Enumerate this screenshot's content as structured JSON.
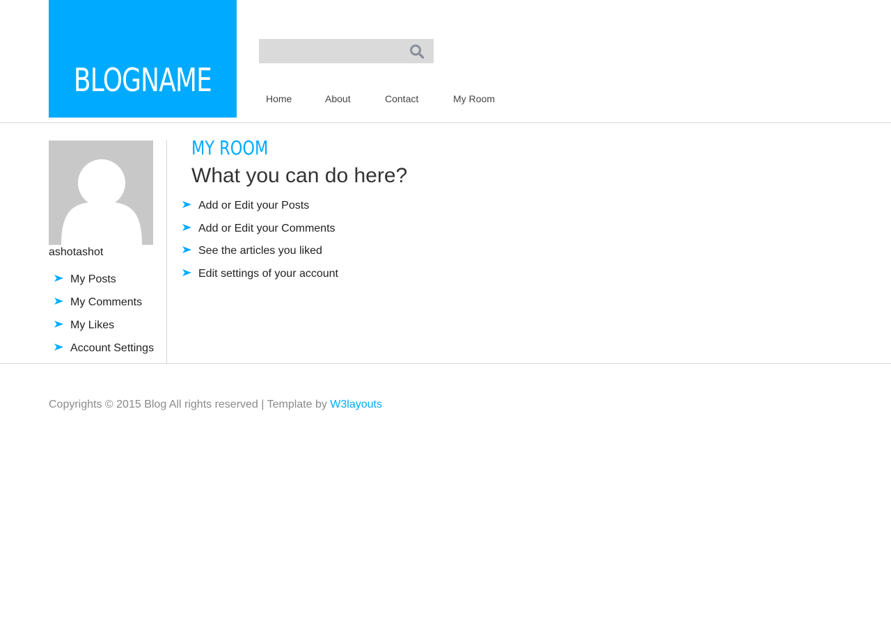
{
  "colors": {
    "accent": "#00abff",
    "rule": "#d6d6d6",
    "search_bg": "#dadada",
    "avatar_bg": "#c8c8c8"
  },
  "header": {
    "logo": "BLOGNAME",
    "search": {
      "value": "",
      "placeholder": "",
      "icon": "search-icon"
    },
    "nav": [
      {
        "label": "Home"
      },
      {
        "label": "About"
      },
      {
        "label": "Contact"
      },
      {
        "label": "My Room"
      }
    ]
  },
  "sidebar": {
    "avatar_icon": "user-silhouette-icon",
    "username": "ashotashot",
    "bullet_icon": "arrow-bullet-icon",
    "links": [
      {
        "label": "My Posts"
      },
      {
        "label": "My Comments"
      },
      {
        "label": "My Likes"
      },
      {
        "label": "Account Settings"
      }
    ]
  },
  "main": {
    "section_title": "MY ROOM",
    "heading": "What you can do here?",
    "items": [
      {
        "label": "Add or Edit your Posts"
      },
      {
        "label": "Add or Edit your Comments"
      },
      {
        "label": "See the articles you liked"
      },
      {
        "label": "Edit settings of your account"
      }
    ]
  },
  "footer": {
    "text": "Copyrights © 2015 Blog All rights reserved | Template by ",
    "link_label": "W3layouts"
  }
}
